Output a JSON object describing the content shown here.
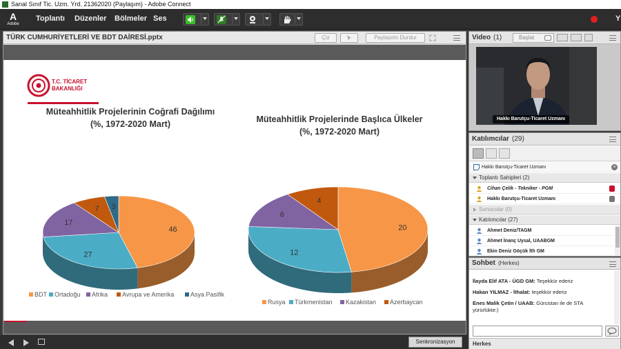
{
  "window": {
    "title": "Sanal Sınıf Tic. Uzm. Yrd. 21362020 (Paylaşım) - Adobe Connect"
  },
  "menubar": {
    "logo_text": "Adobe",
    "items": [
      "Toplantı",
      "Düzenler",
      "Bölmeler",
      "Ses"
    ]
  },
  "share": {
    "title": "TÜRK CUMHURİYETLERİ VE BDT DAİRESİ.pptx",
    "draw_label": "Çiz",
    "stop_label": "Paylaşımı Durdur",
    "sync_label": "Senkronizasyon"
  },
  "slide": {
    "logo_line1": "T.C. TİCARET",
    "logo_line2": "BAKANLIĞI",
    "chart1_title_l1": "Müteahhitlik Projelerinin Coğrafi Dağılımı",
    "chart1_title_l2": "(%, 1972-2020 Mart)",
    "chart2_title_l1": "Müteahhitlik Projelerinde Başlıca Ülkeler",
    "chart2_title_l2": "(%, 1972-2020 Mart)"
  },
  "chart_data": [
    {
      "type": "pie",
      "title": "Müteahhitlik Projelerinin Coğrafi Dağılımı (%, 1972-2020 Mart)",
      "categories": [
        "BDT",
        "Ortadoğu",
        "Afrika",
        "Avrupa ve Amerika",
        "Asya Pasifik"
      ],
      "values": [
        46,
        27,
        17,
        7,
        3
      ],
      "colors": [
        "#f79646",
        "#4bacc6",
        "#8064a2",
        "#c0590e",
        "#2f6a88"
      ],
      "legend": "bottom"
    },
    {
      "type": "pie",
      "title": "Müteahhitlik Projelerinde Başlıca Ülkeler (%, 1972-2020 Mart)",
      "categories": [
        "Rusya",
        "Türkmenistan",
        "Kazakistan",
        "Azerbaycan"
      ],
      "values": [
        20,
        12,
        6,
        4
      ],
      "colors": [
        "#f79646",
        "#4bacc6",
        "#8064a2",
        "#c0590e"
      ],
      "legend": "bottom"
    }
  ],
  "video": {
    "title": "Video",
    "count": "(1)",
    "start_label": "Başlat",
    "caption": "Hakkı Barutçu-Ticaret Uzmanı"
  },
  "participants": {
    "title": "Katılımcılar",
    "count": "(29)",
    "me": "Hakkı Barutçu-Ticaret Uzmanı",
    "hosts_label": "Toplantı Sahipleri (2)",
    "hosts": [
      "Cihan Çelik - Tekniker - PGM",
      "Hakkı Barutçu-Ticaret Uzmanı"
    ],
    "presenters_label": "Sunucular (0)",
    "attendees_label": "Katılımcılar (27)",
    "attendees": [
      "Ahmet Deniz/TAGM",
      "Ahmet İnanç Uysal, UAABGM",
      "Ekin Deniz Göçük İth GM"
    ]
  },
  "chat": {
    "title": "Sohbet",
    "scope": "(Herkes)",
    "messages": [
      {
        "sender": "İlayda Elif ATA - ÜGD GM:",
        "text": "Teşekkür ederiz"
      },
      {
        "sender": "Hakan YILMAZ - İthalat:",
        "text": "teşekkür ederiz"
      },
      {
        "sender": "Enes Malik Çetin / UAAB:",
        "text": "Gürcistan ile de STA"
      },
      {
        "sender": "",
        "text": "yürürlükte:)"
      }
    ],
    "input_placeholder": "",
    "recipient": "Herkes"
  },
  "colors": {
    "accent_red": "#c8102e",
    "speaker_green": "#3bbf2a"
  }
}
